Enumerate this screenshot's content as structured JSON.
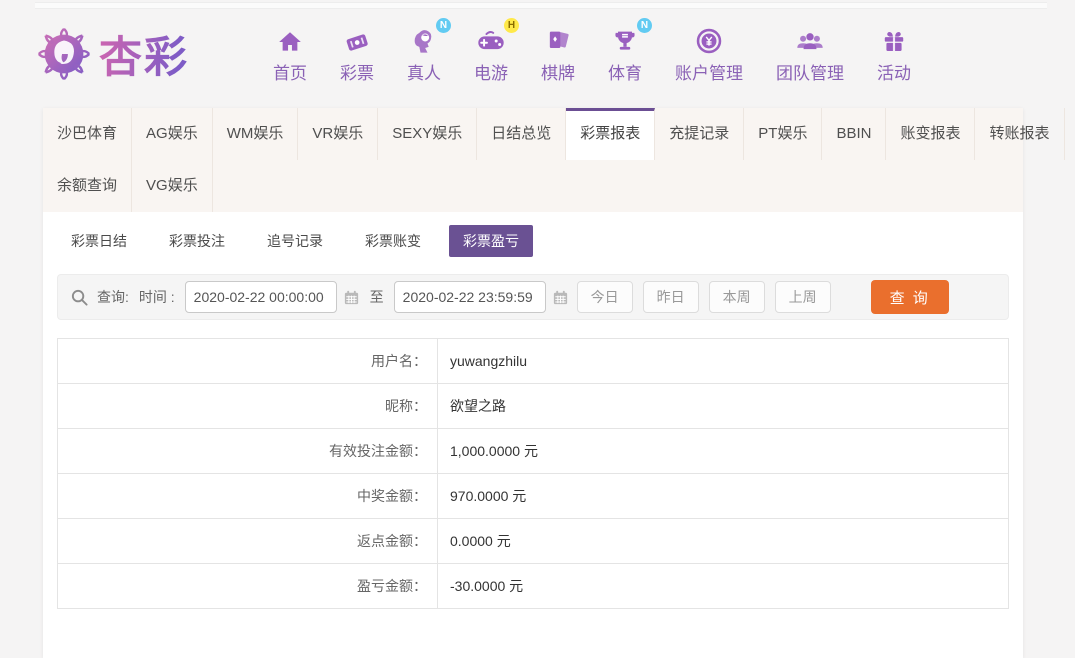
{
  "colors": {
    "accent_purple": "#6a5193",
    "nav_purple": "#8a61b5",
    "tab_bar_bg": "#f9f5f2",
    "submit_orange": "#ea6f2d",
    "badge_blue": "#62cbf2",
    "badge_yellow": "#ffe94a"
  },
  "logo": {
    "brand": "杏彩",
    "mark": "rose-flower-emblem"
  },
  "nav": {
    "items": [
      {
        "label": "首页",
        "icon": "home-icon",
        "badge": ""
      },
      {
        "label": "彩票",
        "icon": "ticket-icon",
        "badge": ""
      },
      {
        "label": "真人",
        "icon": "live-person-icon",
        "badge": "N"
      },
      {
        "label": "电游",
        "icon": "gamepad-icon",
        "badge": "H"
      },
      {
        "label": "棋牌",
        "icon": "cards-icon",
        "badge": ""
      },
      {
        "label": "体育",
        "icon": "trophy-icon",
        "badge": "N"
      },
      {
        "label": "账户管理",
        "icon": "coin-yuan-icon",
        "badge": ""
      },
      {
        "label": "团队管理",
        "icon": "team-icon",
        "badge": ""
      },
      {
        "label": "活动",
        "icon": "gift-icon",
        "badge": ""
      }
    ]
  },
  "tabs": {
    "active": "彩票报表",
    "row1": [
      "沙巴体育",
      "AG娱乐",
      "WM娱乐",
      "VR娱乐",
      "SEXY娱乐",
      "日结总览",
      "彩票报表",
      "充提记录",
      "PT娱乐",
      "BBIN",
      "账变报表",
      "转账报表"
    ],
    "row2": [
      "余额查询",
      "VG娱乐"
    ]
  },
  "subtabs": {
    "active": "彩票盈亏",
    "items": [
      "彩票日结",
      "彩票投注",
      "追号记录",
      "彩票账变",
      "彩票盈亏"
    ]
  },
  "query": {
    "search_label": "查询:",
    "time_label": "时间 :",
    "from_value": "2020-02-22 00:00:00",
    "to_separator": "至",
    "to_value": "2020-02-22 23:59:59",
    "quick_buttons": [
      "今日",
      "昨日",
      "本周",
      "上周"
    ],
    "submit_label": "查 询"
  },
  "report": {
    "rows": [
      {
        "label": "用户名：",
        "value": "yuwangzhilu"
      },
      {
        "label": "昵称：",
        "value": "欲望之路"
      },
      {
        "label": "有效投注金额：",
        "value": "1,000.0000 元"
      },
      {
        "label": "中奖金额：",
        "value": "970.0000 元"
      },
      {
        "label": "返点金额：",
        "value": "0.0000 元"
      },
      {
        "label": "盈亏金额：",
        "value": "-30.0000 元"
      }
    ]
  }
}
